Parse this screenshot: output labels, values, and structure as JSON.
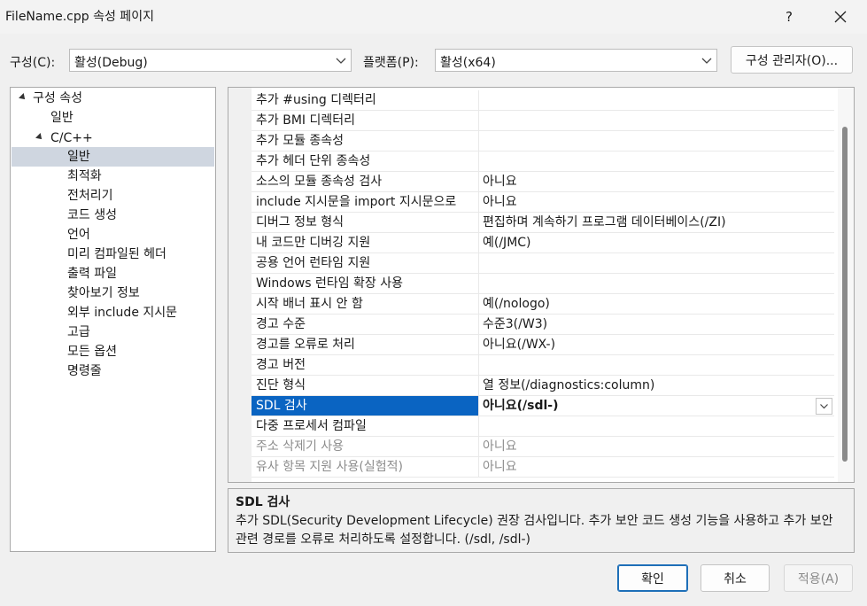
{
  "window": {
    "title": "FileName.cpp 속성 페이지",
    "help_glyph": "?"
  },
  "config": {
    "label": "구성(C):",
    "value": "활성(Debug)",
    "platform_label": "플랫폼(P):",
    "platform_value": "활성(x64)",
    "manager_button": "구성 관리자(O)..."
  },
  "tree": {
    "root": "구성 속성",
    "general": "일반",
    "cpp": "C/C++",
    "items": [
      "일반",
      "최적화",
      "전처리기",
      "코드 생성",
      "언어",
      "미리 컴파일된 헤더",
      "출력 파일",
      "찾아보기 정보",
      "외부 include 지시문",
      "고급",
      "모든 옵션",
      "명령줄"
    ],
    "selected": "일반"
  },
  "properties": [
    {
      "name": "추가 #using 디렉터리",
      "value": ""
    },
    {
      "name": "추가 BMI 디렉터리",
      "value": ""
    },
    {
      "name": "추가 모듈 종속성",
      "value": ""
    },
    {
      "name": "추가 헤더 단위 종속성",
      "value": ""
    },
    {
      "name": "소스의 모듈 종속성 검사",
      "value": "아니요"
    },
    {
      "name": "include 지시문을 import 지시문으로",
      "value": "아니요"
    },
    {
      "name": "디버그 정보 형식",
      "value": "편집하며 계속하기 프로그램 데이터베이스(/ZI)"
    },
    {
      "name": "내 코드만 디버깅 지원",
      "value": "예(/JMC)"
    },
    {
      "name": "공용 언어 런타임 지원",
      "value": ""
    },
    {
      "name": "Windows 런타임 확장 사용",
      "value": ""
    },
    {
      "name": "시작 배너 표시 안 함",
      "value": "예(/nologo)"
    },
    {
      "name": "경고 수준",
      "value": "수준3(/W3)"
    },
    {
      "name": "경고를 오류로 처리",
      "value": "아니요(/WX-)"
    },
    {
      "name": "경고 버전",
      "value": ""
    },
    {
      "name": "진단 형식",
      "value": "열 정보(/diagnostics:column)"
    },
    {
      "name": "SDL 검사",
      "value": "아니요(/sdl-)",
      "selected": true
    },
    {
      "name": "다중 프로세서 컴파일",
      "value": ""
    },
    {
      "name": "주소 삭제기 사용",
      "value": "아니요",
      "disabled": true
    },
    {
      "name": "유사 항목 지원 사용(실험적)",
      "value": "아니요",
      "disabled": true
    }
  ],
  "description": {
    "title": "SDL 검사",
    "text": "추가 SDL(Security Development Lifecycle) 권장 검사입니다. 추가 보안 코드 생성 기능을 사용하고 추가 보안 관련 경로를 오류로 처리하도록 설정합니다. (/sdl, /sdl-)"
  },
  "buttons": {
    "ok": "확인",
    "cancel": "취소",
    "apply": "적용(A)"
  },
  "colors": {
    "selection": "#0a64c2",
    "tree_selection": "#cfd6e0",
    "default_border": "#1e6fb8"
  }
}
